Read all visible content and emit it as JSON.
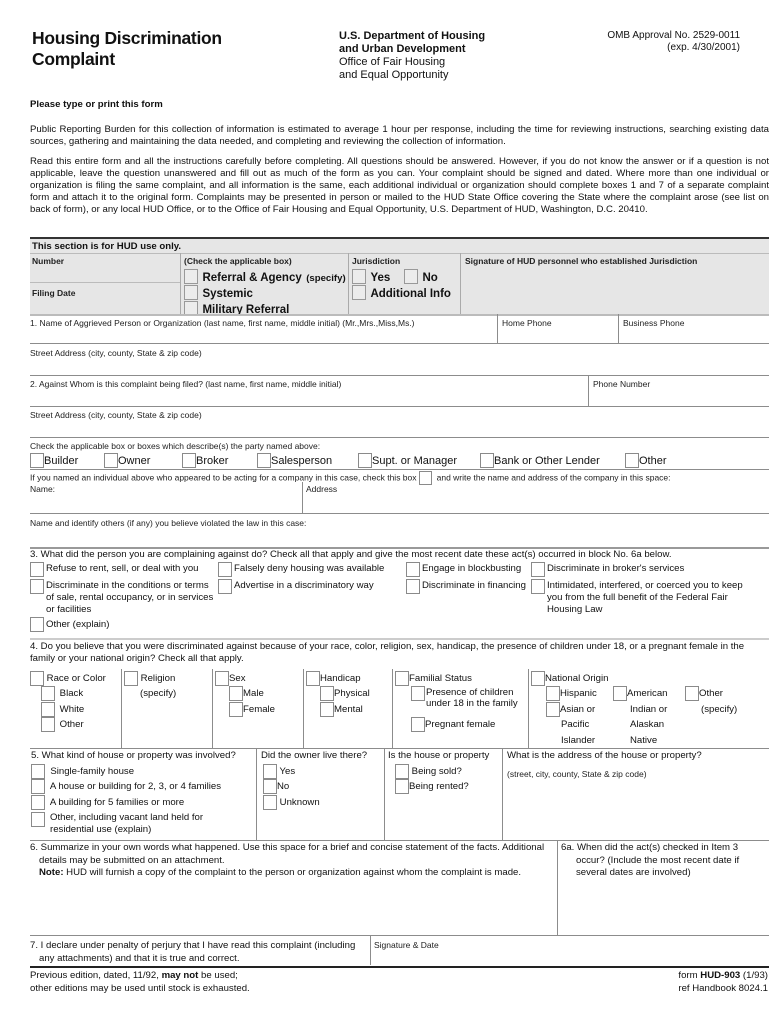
{
  "header": {
    "title_line1": "Housing Discrimination",
    "title_line2": "Complaint",
    "agency_line1": "U.S. Department of Housing",
    "agency_line2": "and Urban Development",
    "agency_line3": "Office of Fair Housing",
    "agency_line4": "and Equal Opportunity",
    "omb_line1": "OMB Approval No. 2529-0011",
    "omb_line2": "(exp. 4/30/2001)"
  },
  "instructions": {
    "please": "Please type or print this form",
    "burden": "Public Reporting Burden for this collection of information is estimated to average 1 hour per response, including the time for reviewing instructions, searching existing data sources, gathering and maintaining the data needed, and completing and reviewing the collection of information.",
    "read": "Read this entire form and all the instructions carefully before completing.  All questions should be answered.  However, if you do not know the answer or if a question is not applicable, leave the question unanswered and fill out as much of the form as you can.  Your complaint should be signed and dated.  Where more than one individual or organization is filing the same complaint, and all information is the same, each additional individual or organization should complete boxes 1 and 7 of a separate complaint form and attach it to the original form.  Complaints may be presented in person or mailed to the HUD State Office covering the State where the complaint arose (see list on back of form), or any local HUD Office, or to the Office of Fair Housing and Equal Opportunity, U.S. Department of HUD, Washington, D.C. 20410."
  },
  "hud": {
    "heading": "This section is for HUD use only.",
    "number": "Number",
    "filing_date": "Filing Date",
    "check_heading": "(Check the applicable box)",
    "referral": "Referral & Agency",
    "specify": "(specify)",
    "systemic": "Systemic",
    "military": "Military  Referral",
    "jurisdiction": "Jurisdiction",
    "yes": "Yes",
    "no": "No",
    "additional": "Additional  Info",
    "signature": "Signature of HUD personnel who established Jurisdiction"
  },
  "section1": {
    "name_label": "1.  Name of Aggrieved Person or Organization  (last name, first name, middle initial) (Mr.,Mrs.,Miss,Ms.)",
    "home_phone": "Home Phone",
    "business_phone": "Business Phone",
    "street": "Street Address (city, county, State & zip code)"
  },
  "section2": {
    "against_label": "2.  Against Whom is this complaint being filed?   (last name, first name, middle initial)",
    "phone": "Phone Number",
    "street": "Street Address (city, county, State & zip code)",
    "check_party": "Check the applicable box or boxes which describe(s) the party named above:",
    "parties": [
      "Builder",
      "Owner",
      "Broker",
      "Salesperson",
      "Supt. or Manager",
      "Bank or Other Lender",
      "Other"
    ],
    "company_pre": "If you named an individual above who appeared to be acting for a company in this case, check  this box",
    "company_post": "and write the name and address of the company in this space:",
    "name": "Name:",
    "address": "Address",
    "others": "Name and identify others (if any) you believe violated the law in this case:"
  },
  "section3": {
    "question": "3. What did the person you are complaining against do? Check all that apply and give the most recent date these act(s) occurred in block No. 6a below.",
    "options": [
      "Refuse to rent, sell, or deal with you",
      "Falsely deny housing was available",
      "Engage in blockbusting",
      "Discriminate in broker's services",
      "Discriminate in the conditions or terms of sale, rental occupancy, or in services or facilities",
      "Advertise in a discriminatory way",
      "Discriminate in financing",
      "Intimidated, interfered, or coerced you to keep you from the full benefit of the Federal Fair Housing Law",
      "Other (explain)"
    ]
  },
  "section4": {
    "question": "4. Do you believe that you were discriminated against because of your race, color, religion, sex, handicap, the presence of children under 18, or a pregnant female in the family or your national origin? Check all that apply.",
    "race": "Race or Color",
    "black": "Black",
    "white": "White",
    "other": "Other",
    "religion": "Religion",
    "specify": "(specify)",
    "sex": "Sex",
    "male": "Male",
    "female": "Female",
    "handicap": "Handicap",
    "physical": "Physical",
    "mental": "Mental",
    "familial": "Familial Status",
    "children": "Presence of children under 18 in the family",
    "pregnant": "Pregnant female",
    "national": "National Origin",
    "hispanic": "Hispanic",
    "asian": "Asian or",
    "pacific": "Pacific",
    "islander": "Islander",
    "american": "American",
    "indian": "Indian or",
    "alaskan": "Alaskan",
    "native": "Native",
    "other_no": "Other",
    "other_specify": "(specify)"
  },
  "section5": {
    "question": "5. What kind of house or property was involved?",
    "types": [
      "Single-family house",
      "A house or building for 2, 3, or 4 families",
      "A building for 5 families or more",
      "Other, including vacant land held for residential use (explain)"
    ],
    "owner_q": "Did the owner live there?",
    "owner_opts": [
      "Yes",
      "No",
      "Unknown"
    ],
    "property_q": "Is the house or property",
    "property_opts": [
      "Being sold?",
      "Being rented?"
    ],
    "address_q": "What is the address of the house or property?",
    "address_hint": "(street, city, county, State & zip code)"
  },
  "section6": {
    "summary": "6.  Summarize in your own words what happened. Use this space for a brief and concise statement of the facts. Additional details may be submitted on an attachment.",
    "note_bold": "Note:",
    "note": " HUD will furnish a copy of the complaint to the person or organization against whom the complaint is made.",
    "when": "6a. When did the act(s) checked in Item 3 occur? (Include the most recent date if several dates are involved)"
  },
  "section7": {
    "declare": "7. I declare under penalty of perjury that I have read this complaint (including any attachments) and that it is true and correct.",
    "signature": "Signature & Date"
  },
  "footer": {
    "prev_pre": "Previous edition, dated, 11/92,  ",
    "prev_bold": "may not",
    "prev_post": " be used;",
    "other_editions": "other editions may be used until stock is exhausted.",
    "form_pre": "form ",
    "form_bold": "HUD-903",
    "form_post": " (1/93)",
    "handbook": "ref Handbook 8024.1"
  }
}
